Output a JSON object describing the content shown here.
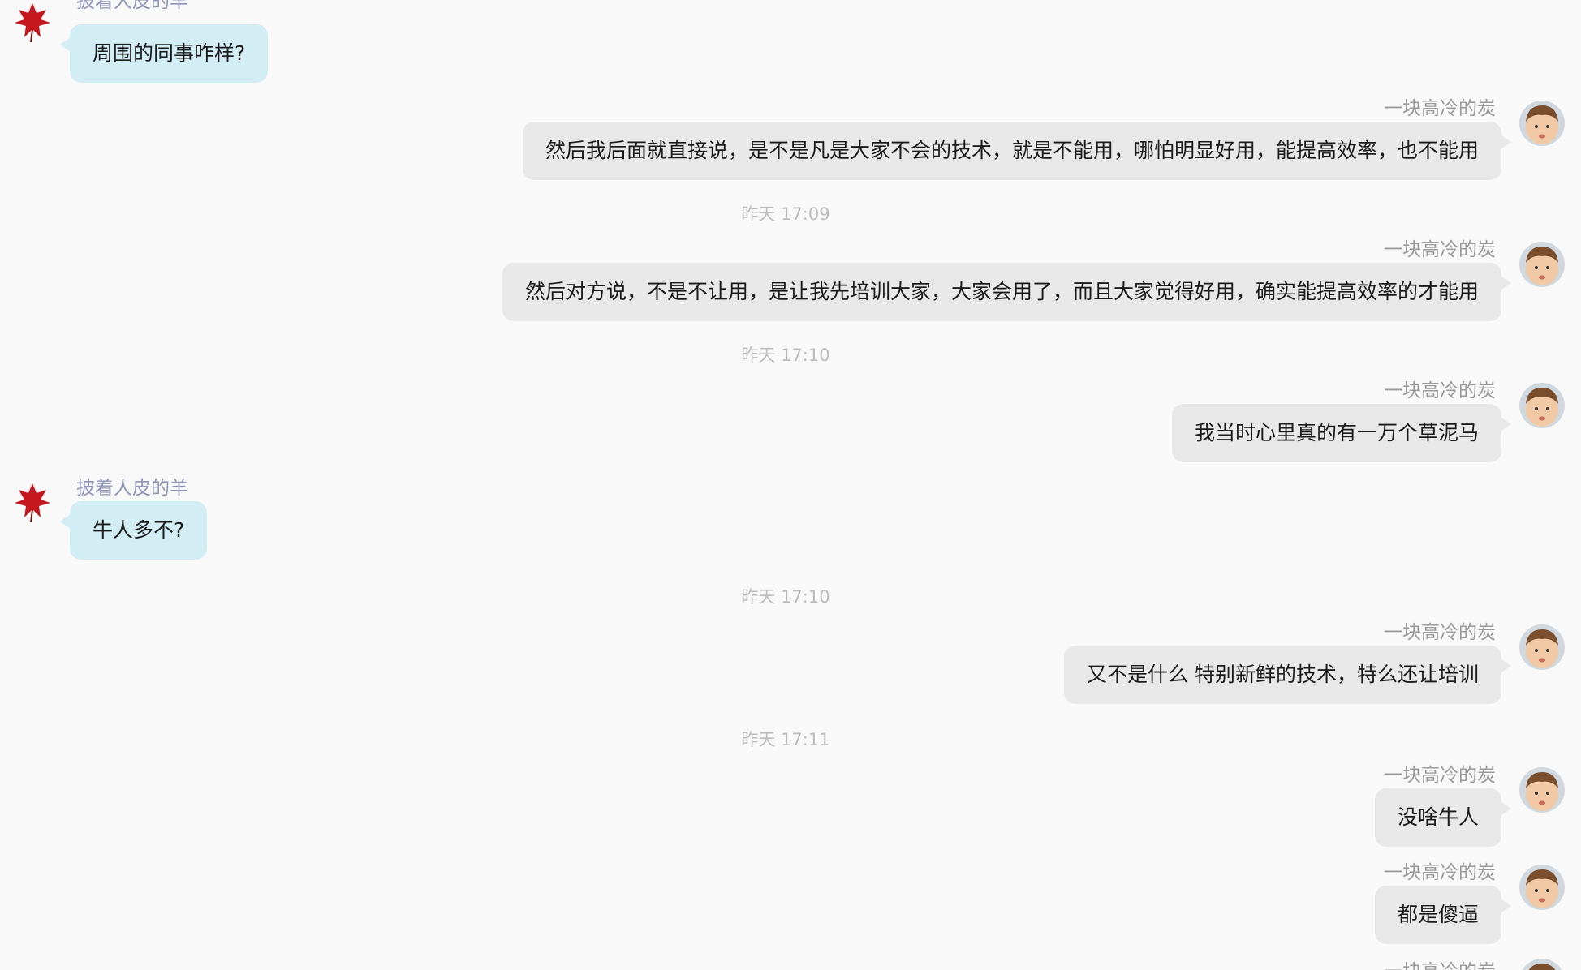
{
  "conversation": {
    "messages": [
      {
        "id": "m1",
        "side": "left",
        "sender": "披着人皮的羊",
        "text": "周围的同事咋样?"
      },
      {
        "id": "m2",
        "side": "right",
        "sender": "一块高冷的炭",
        "text": "然后我后面就直接说，是不是凡是大家不会的技术，就是不能用，哪怕明显好用，能提高效率，也不能用"
      },
      {
        "id": "m3",
        "side": "right",
        "sender": "一块高冷的炭",
        "text": "然后对方说，不是不让用，是让我先培训大家，大家会用了，而且大家觉得好用，确实能提高效率的才能用"
      },
      {
        "id": "m4",
        "side": "right",
        "sender": "一块高冷的炭",
        "text": "我当时心里真的有一万个草泥马"
      },
      {
        "id": "m5",
        "side": "left",
        "sender": "披着人皮的羊",
        "text": "牛人多不?"
      },
      {
        "id": "m6",
        "side": "right",
        "sender": "一块高冷的炭",
        "text": "又不是什么 特别新鲜的技术，特么还让培训"
      },
      {
        "id": "m7",
        "side": "right",
        "sender": "一块高冷的炭",
        "text": "没啥牛人"
      },
      {
        "id": "m8",
        "side": "right",
        "sender": "一块高冷的炭",
        "text": "都是傻逼"
      },
      {
        "id": "m9",
        "side": "right",
        "sender": "一块高冷的炭",
        "text": ""
      }
    ],
    "timestamps": [
      {
        "id": "t1",
        "text": "昨天  17:09"
      },
      {
        "id": "t2",
        "text": "昨天  17:10"
      },
      {
        "id": "t3",
        "text": "昨天  17:10"
      },
      {
        "id": "t4",
        "text": "昨天  17:11"
      }
    ]
  },
  "colors": {
    "background": "#f9f9f9",
    "incoming_bubble": "#d3edf5",
    "outgoing_bubble": "#e8e8e8",
    "incoming_sender": "#8e95b8",
    "outgoing_sender": "#9a9a9a",
    "timestamp": "#bcbcbc"
  },
  "icons": {
    "incoming_avatar": "red-autumn-leaf-avatar",
    "outgoing_avatar": "pouting-child-face-avatar"
  }
}
